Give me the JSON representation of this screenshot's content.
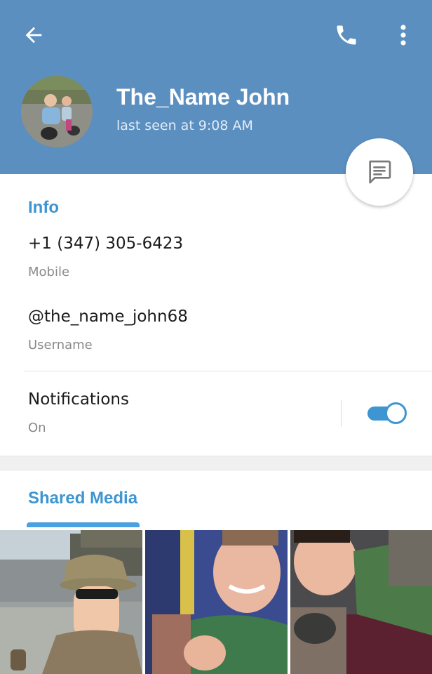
{
  "header": {
    "name": "The_Name John",
    "status": "last seen at 9:08 AM",
    "icons": {
      "back": "arrow-left-icon",
      "call": "phone-icon",
      "more": "more-vertical-icon",
      "message": "message-icon"
    }
  },
  "info": {
    "title": "Info",
    "phone": {
      "value": "+1 (347) 305-6423",
      "label": "Mobile"
    },
    "username": {
      "value": "@the_name_john68",
      "label": "Username"
    },
    "notifications": {
      "title": "Notifications",
      "status": "On"
    }
  },
  "shared_media": {
    "title": "Shared Media",
    "items": [
      "photo-1",
      "photo-2",
      "photo-3"
    ]
  },
  "colors": {
    "header_bg": "#5b8fc0",
    "accent": "#3d95d1",
    "toggle": "#3d95d1"
  }
}
